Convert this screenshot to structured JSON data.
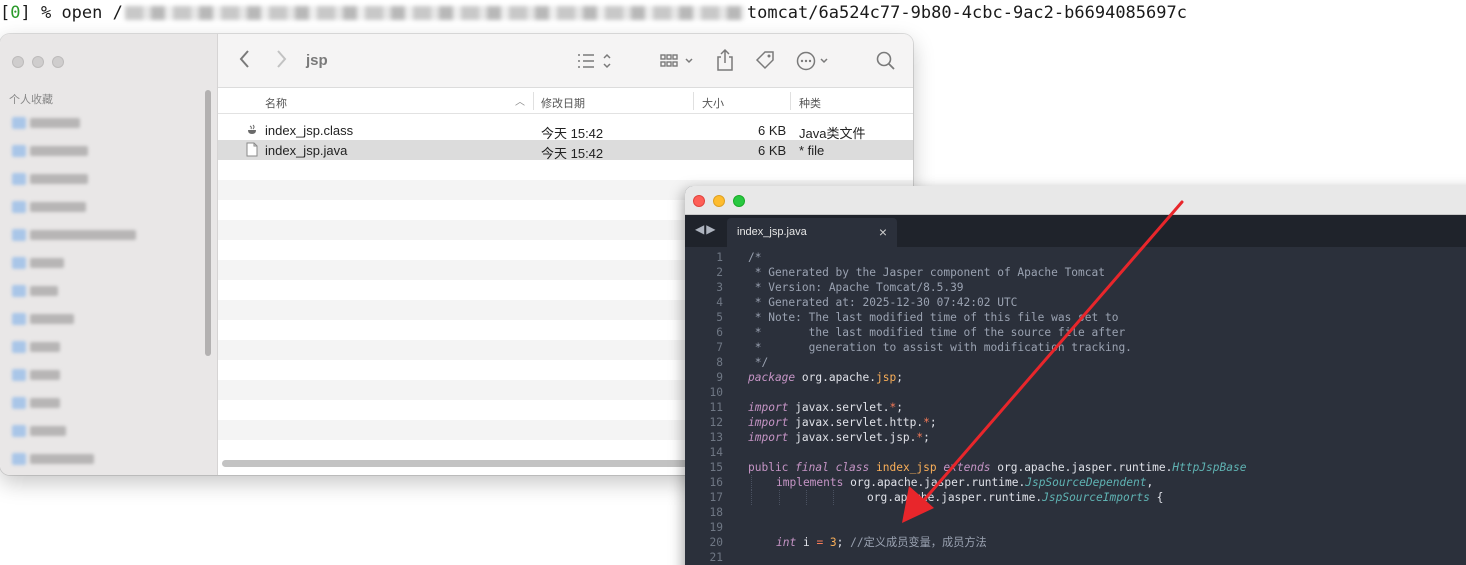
{
  "terminal": {
    "prompt_open": "[",
    "prompt_num": "0",
    "prompt_rest": "] % open /",
    "path_tail": "tomcat/6a524c77-9b80-4cbc-9ac2-b6694085697c"
  },
  "finder": {
    "sidebar_title": "个人收藏",
    "folder_title": "jsp",
    "columns": {
      "name": "名称",
      "date": "修改日期",
      "size": "大小",
      "kind": "种类"
    },
    "files": [
      {
        "name": "index_jsp.class",
        "date": "今天 15:42",
        "size": "6 KB",
        "kind": "Java类文件",
        "icon": "java-class-icon"
      },
      {
        "name": "index_jsp.java",
        "date": "今天 15:42",
        "size": "6 KB",
        "kind": "* file",
        "icon": "document-icon"
      }
    ]
  },
  "editor": {
    "tab_title": "index_jsp.java",
    "line_numbers": [
      "1",
      "2",
      "3",
      "4",
      "5",
      "6",
      "7",
      "8",
      "9",
      "10",
      "11",
      "12",
      "13",
      "14",
      "15",
      "16",
      "17",
      "18",
      "19",
      "20",
      "21"
    ],
    "lines": {
      "l1": "/*",
      "l2": " * Generated by the Jasper component of Apache Tomcat",
      "l3": " * Version: Apache Tomcat/8.5.39",
      "l4": " * Generated at: 2025-12-30 07:42:02 UTC",
      "l5": " * Note: The last modified time of this file was set to",
      "l6": " *       the last modified time of the source file after",
      "l7": " *       generation to assist with modification tracking.",
      "l8": " */",
      "l9_kw": "package",
      "l9_a": " org.apache.",
      "l9_b": "jsp",
      "l9_c": ";",
      "import_kw": "import",
      "l11": " javax.servlet.",
      "l12": " javax.servlet.http.",
      "l13": " javax.servlet.jsp.",
      "star": "*",
      "semi": ";",
      "l15_public": "public",
      "l15_final": " final",
      "l15_class": " class",
      "l15_name": " index_jsp",
      "l15_extends": " extends",
      "l15_pkg": " org.apache.jasper.runtime.",
      "l15_type": "HttpJspBase",
      "l16_impl": "implements",
      "l16_pkg": " org.apache.jasper.runtime.",
      "l16_type": "JspSourceDependent",
      "l16_end": ",",
      "l17_pkg": "org.apache.jasper.runtime.",
      "l17_type": "JspSourceImports",
      "l17_end": " {",
      "l20_kw": "int",
      "l20_var": " i ",
      "l20_eq": "=",
      "l20_num": " 3",
      "l20_semi": ";",
      "l20_comment": " //定义成员变量，成员方法"
    }
  },
  "annotation": {
    "arrow_color": "#e8262b"
  }
}
